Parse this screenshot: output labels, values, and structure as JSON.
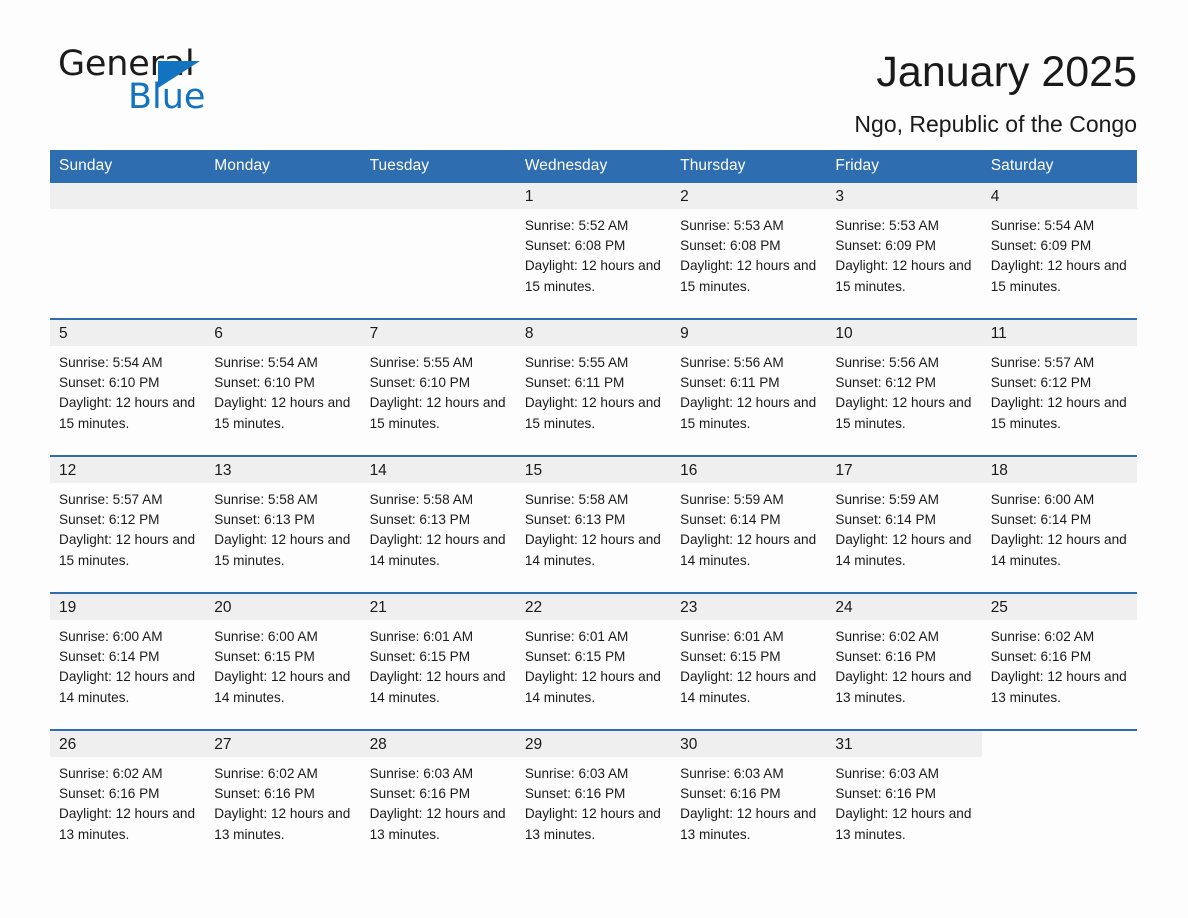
{
  "brand": {
    "name_part1": "General",
    "name_part2": "Blue",
    "accent_color": "#1273c0",
    "triangle_icon": "triangle-icon"
  },
  "header": {
    "month_title": "January 2025",
    "location": "Ngo, Republic of the Congo"
  },
  "calendar": {
    "header_bg": "#2e6daf",
    "daynum_bg": "#efefef",
    "weekday_headers": [
      "Sunday",
      "Monday",
      "Tuesday",
      "Wednesday",
      "Thursday",
      "Friday",
      "Saturday"
    ],
    "weeks": [
      [
        {
          "day": "",
          "empty": true
        },
        {
          "day": "",
          "empty": true
        },
        {
          "day": "",
          "empty": true
        },
        {
          "day": "1",
          "sunrise": "Sunrise: 5:52 AM",
          "sunset": "Sunset: 6:08 PM",
          "daylight": "Daylight: 12 hours and 15 minutes."
        },
        {
          "day": "2",
          "sunrise": "Sunrise: 5:53 AM",
          "sunset": "Sunset: 6:08 PM",
          "daylight": "Daylight: 12 hours and 15 minutes."
        },
        {
          "day": "3",
          "sunrise": "Sunrise: 5:53 AM",
          "sunset": "Sunset: 6:09 PM",
          "daylight": "Daylight: 12 hours and 15 minutes."
        },
        {
          "day": "4",
          "sunrise": "Sunrise: 5:54 AM",
          "sunset": "Sunset: 6:09 PM",
          "daylight": "Daylight: 12 hours and 15 minutes."
        }
      ],
      [
        {
          "day": "5",
          "sunrise": "Sunrise: 5:54 AM",
          "sunset": "Sunset: 6:10 PM",
          "daylight": "Daylight: 12 hours and 15 minutes."
        },
        {
          "day": "6",
          "sunrise": "Sunrise: 5:54 AM",
          "sunset": "Sunset: 6:10 PM",
          "daylight": "Daylight: 12 hours and 15 minutes."
        },
        {
          "day": "7",
          "sunrise": "Sunrise: 5:55 AM",
          "sunset": "Sunset: 6:10 PM",
          "daylight": "Daylight: 12 hours and 15 minutes."
        },
        {
          "day": "8",
          "sunrise": "Sunrise: 5:55 AM",
          "sunset": "Sunset: 6:11 PM",
          "daylight": "Daylight: 12 hours and 15 minutes."
        },
        {
          "day": "9",
          "sunrise": "Sunrise: 5:56 AM",
          "sunset": "Sunset: 6:11 PM",
          "daylight": "Daylight: 12 hours and 15 minutes."
        },
        {
          "day": "10",
          "sunrise": "Sunrise: 5:56 AM",
          "sunset": "Sunset: 6:12 PM",
          "daylight": "Daylight: 12 hours and 15 minutes."
        },
        {
          "day": "11",
          "sunrise": "Sunrise: 5:57 AM",
          "sunset": "Sunset: 6:12 PM",
          "daylight": "Daylight: 12 hours and 15 minutes."
        }
      ],
      [
        {
          "day": "12",
          "sunrise": "Sunrise: 5:57 AM",
          "sunset": "Sunset: 6:12 PM",
          "daylight": "Daylight: 12 hours and 15 minutes."
        },
        {
          "day": "13",
          "sunrise": "Sunrise: 5:58 AM",
          "sunset": "Sunset: 6:13 PM",
          "daylight": "Daylight: 12 hours and 15 minutes."
        },
        {
          "day": "14",
          "sunrise": "Sunrise: 5:58 AM",
          "sunset": "Sunset: 6:13 PM",
          "daylight": "Daylight: 12 hours and 14 minutes."
        },
        {
          "day": "15",
          "sunrise": "Sunrise: 5:58 AM",
          "sunset": "Sunset: 6:13 PM",
          "daylight": "Daylight: 12 hours and 14 minutes."
        },
        {
          "day": "16",
          "sunrise": "Sunrise: 5:59 AM",
          "sunset": "Sunset: 6:14 PM",
          "daylight": "Daylight: 12 hours and 14 minutes."
        },
        {
          "day": "17",
          "sunrise": "Sunrise: 5:59 AM",
          "sunset": "Sunset: 6:14 PM",
          "daylight": "Daylight: 12 hours and 14 minutes."
        },
        {
          "day": "18",
          "sunrise": "Sunrise: 6:00 AM",
          "sunset": "Sunset: 6:14 PM",
          "daylight": "Daylight: 12 hours and 14 minutes."
        }
      ],
      [
        {
          "day": "19",
          "sunrise": "Sunrise: 6:00 AM",
          "sunset": "Sunset: 6:14 PM",
          "daylight": "Daylight: 12 hours and 14 minutes."
        },
        {
          "day": "20",
          "sunrise": "Sunrise: 6:00 AM",
          "sunset": "Sunset: 6:15 PM",
          "daylight": "Daylight: 12 hours and 14 minutes."
        },
        {
          "day": "21",
          "sunrise": "Sunrise: 6:01 AM",
          "sunset": "Sunset: 6:15 PM",
          "daylight": "Daylight: 12 hours and 14 minutes."
        },
        {
          "day": "22",
          "sunrise": "Sunrise: 6:01 AM",
          "sunset": "Sunset: 6:15 PM",
          "daylight": "Daylight: 12 hours and 14 minutes."
        },
        {
          "day": "23",
          "sunrise": "Sunrise: 6:01 AM",
          "sunset": "Sunset: 6:15 PM",
          "daylight": "Daylight: 12 hours and 14 minutes."
        },
        {
          "day": "24",
          "sunrise": "Sunrise: 6:02 AM",
          "sunset": "Sunset: 6:16 PM",
          "daylight": "Daylight: 12 hours and 13 minutes."
        },
        {
          "day": "25",
          "sunrise": "Sunrise: 6:02 AM",
          "sunset": "Sunset: 6:16 PM",
          "daylight": "Daylight: 12 hours and 13 minutes."
        }
      ],
      [
        {
          "day": "26",
          "sunrise": "Sunrise: 6:02 AM",
          "sunset": "Sunset: 6:16 PM",
          "daylight": "Daylight: 12 hours and 13 minutes."
        },
        {
          "day": "27",
          "sunrise": "Sunrise: 6:02 AM",
          "sunset": "Sunset: 6:16 PM",
          "daylight": "Daylight: 12 hours and 13 minutes."
        },
        {
          "day": "28",
          "sunrise": "Sunrise: 6:03 AM",
          "sunset": "Sunset: 6:16 PM",
          "daylight": "Daylight: 12 hours and 13 minutes."
        },
        {
          "day": "29",
          "sunrise": "Sunrise: 6:03 AM",
          "sunset": "Sunset: 6:16 PM",
          "daylight": "Daylight: 12 hours and 13 minutes."
        },
        {
          "day": "30",
          "sunrise": "Sunrise: 6:03 AM",
          "sunset": "Sunset: 6:16 PM",
          "daylight": "Daylight: 12 hours and 13 minutes."
        },
        {
          "day": "31",
          "sunrise": "Sunrise: 6:03 AM",
          "sunset": "Sunset: 6:16 PM",
          "daylight": "Daylight: 12 hours and 13 minutes."
        },
        {
          "day": "",
          "empty": true,
          "trailing": true
        }
      ]
    ]
  }
}
